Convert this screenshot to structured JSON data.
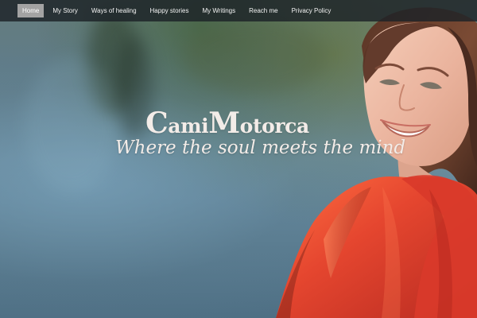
{
  "navigation": {
    "items": [
      {
        "label": "Home",
        "active": true
      },
      {
        "label": "My Story",
        "active": false
      },
      {
        "label": "Ways of healing",
        "active": false
      },
      {
        "label": "Happy stories",
        "active": false
      },
      {
        "label": "My Writings",
        "active": false
      },
      {
        "label": "Reach me",
        "active": false
      },
      {
        "label": "Privacy Policy",
        "active": false
      }
    ]
  },
  "hero": {
    "title": {
      "first_initial": "C",
      "first_rest": "ami",
      "second_initial": "M",
      "second_rest": "otorca"
    },
    "tagline": "Where the soul meets the mind",
    "image": "smiling-woman-in-red-dress-by-water"
  },
  "colors": {
    "nav_background": "#1c2227",
    "active_nav": "#a3a3a3",
    "hero_text": "#f3ece8",
    "water": "#6b8fa5",
    "dress": "#e2422c"
  }
}
